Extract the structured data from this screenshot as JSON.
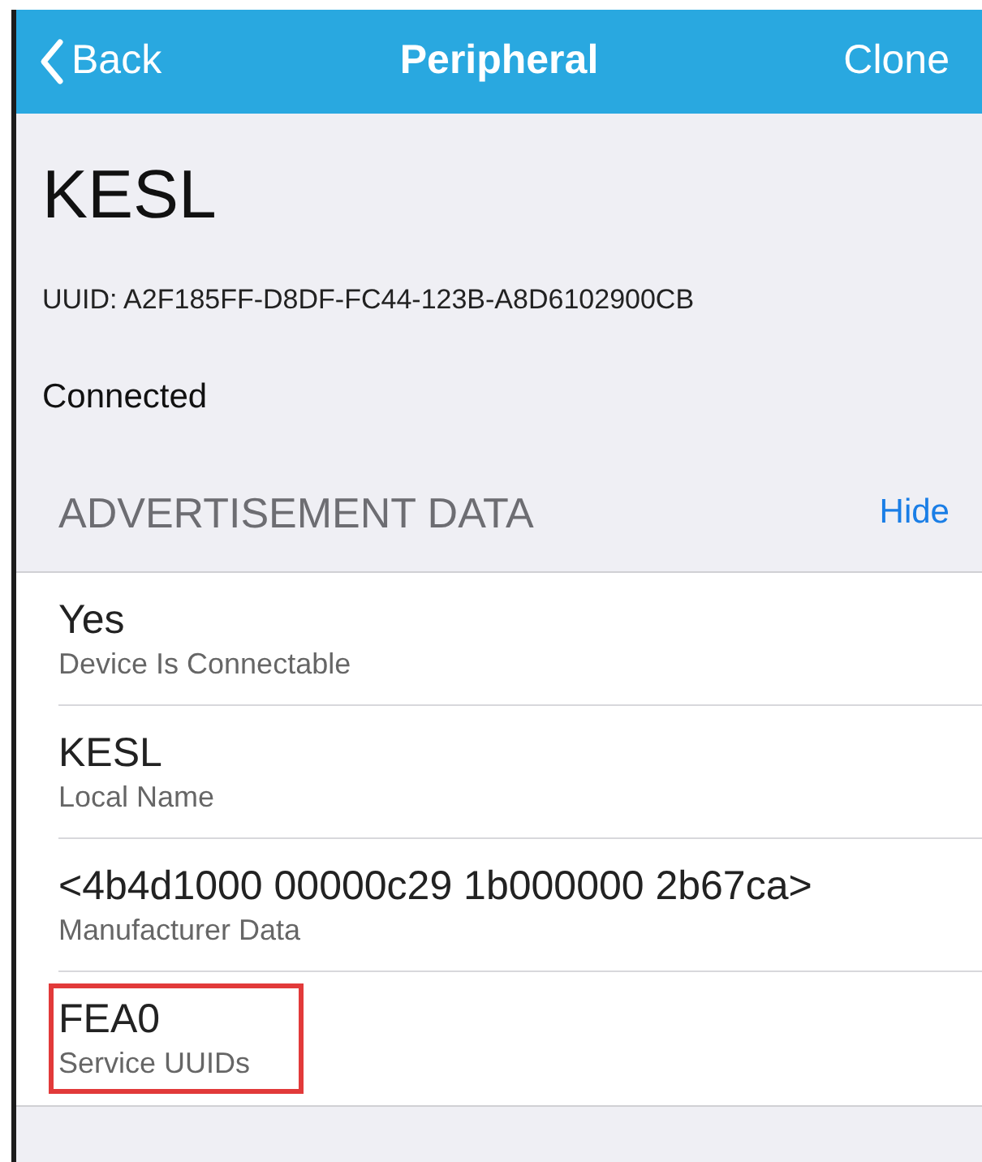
{
  "nav": {
    "back": "Back",
    "title": "Peripheral",
    "action": "Clone"
  },
  "device": {
    "name": "KESL",
    "uuid": "UUID: A2F185FF-D8DF-FC44-123B-A8D6102900CB",
    "status": "Connected"
  },
  "section": {
    "title": "ADVERTISEMENT DATA",
    "action": "Hide"
  },
  "rows": [
    {
      "value": "Yes",
      "label": "Device Is Connectable",
      "highlighted": false
    },
    {
      "value": "KESL",
      "label": "Local Name",
      "highlighted": false
    },
    {
      "value": "<4b4d1000 00000c29 1b000000 2b67ca>",
      "label": "Manufacturer Data",
      "highlighted": false
    },
    {
      "value": "FEA0",
      "label": "Service UUIDs",
      "highlighted": true
    }
  ]
}
